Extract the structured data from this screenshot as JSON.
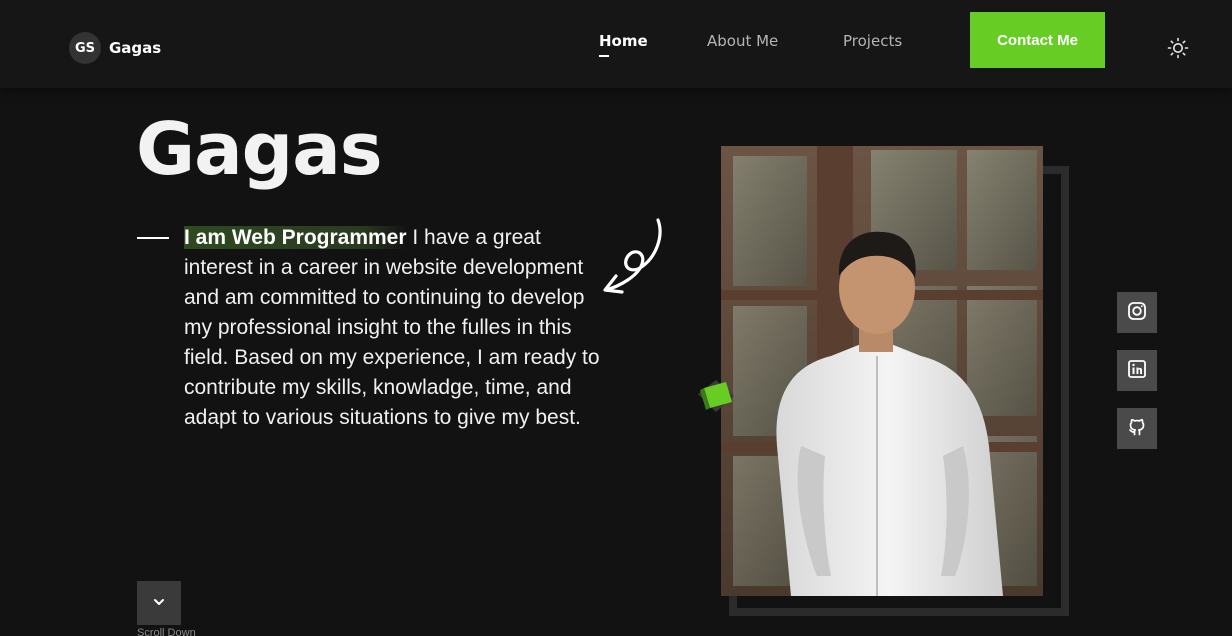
{
  "brand": {
    "initials": "GS",
    "name": "Gagas"
  },
  "nav": {
    "items": [
      {
        "label": "Home",
        "active": true
      },
      {
        "label": "About Me",
        "active": false
      },
      {
        "label": "Projects",
        "active": false
      }
    ],
    "contact_label": "Contact Me"
  },
  "hero": {
    "name": "Gagas",
    "highlight": "I am Web Programmer",
    "description": " I have a great interest in a career in website development and am committed to continuing to develop my professional insight to the fulles in this field. Based on my experience, I am ready to contribute my skills, knowladge, time, and adapt to various situations to give my best."
  },
  "social": [
    {
      "icon": "instagram-icon"
    },
    {
      "icon": "linkedin-icon"
    },
    {
      "icon": "github-icon"
    }
  ],
  "scroll": {
    "label": "Scroll Down"
  },
  "colors": {
    "accent": "#67cd25",
    "background": "#121212",
    "header": "#161616"
  }
}
